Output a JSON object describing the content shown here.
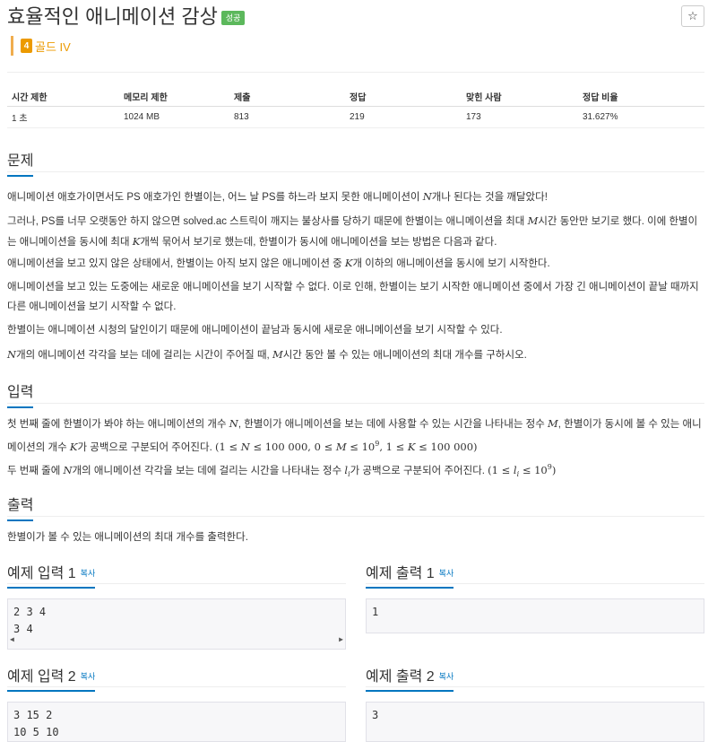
{
  "problem": {
    "title": "효율적인 애니메이션 감상",
    "result_badge": "성공",
    "favorite_icon": "☆",
    "tier_number": "4",
    "tier_label": "골드 IV"
  },
  "stats": {
    "headers": [
      "시간 제한",
      "메모리 제한",
      "제출",
      "정답",
      "맞힌 사람",
      "정답 비율"
    ],
    "values": [
      "1 초",
      "1024 MB",
      "813",
      "219",
      "173",
      "31.627%"
    ]
  },
  "sections": {
    "problem": "문제",
    "input": "입력",
    "output": "출력"
  },
  "statement": {
    "p1a": "애니메이션 애호가이면서도 PS 애호가인 한별이는, 어느 날 PS를 하느라 보지 못한 애니메이션이 ",
    "p1b": "N",
    "p1c": "개나 된다는 것을 깨달았다!",
    "p2a": "그러나, PS를 너무 오랫동안 하지 않으면 solved.ac 스트릭이 깨지는 불상사를 당하기 때문에 한별이는 애니메이션을 최대 ",
    "p2b": "M",
    "p2c": "시간 동안만 보기로 했다. 이에 한별이는 애니메이션을 동시에 최대 ",
    "p2d": "K",
    "p2e": "개씩 묶어서 보기로 했는데, 한별이가 동시에 애니메이션을 보는 방법은 다음과 같다.",
    "p3a": "애니메이션을 보고 있지 않은 상태에서, 한별이는 아직 보지 않은 애니메이션 중 ",
    "p3b": "K",
    "p3c": "개 이하의 애니메이션을 동시에 보기 시작한다.",
    "p4": "애니메이션을 보고 있는 도중에는 새로운 애니메이션을 보기 시작할 수 없다. 이로 인해, 한별이는 보기 시작한 애니메이션 중에서 가장 긴 애니메이션이 끝날 때까지 다른 애니메이션을 보기 시작할 수 없다.",
    "p5": "한별이는 애니메이션 시청의 달인이기 때문에 애니메이션이 끝남과 동시에 새로운 애니메이션을 보기 시작할 수 있다.",
    "p6a": "N",
    "p6b": "개의 애니메이션 각각을 보는 데에 걸리는 시간이 주어질 때, ",
    "p6c": "M",
    "p6d": "시간 동안 볼 수 있는 애니메이션의 최대 개수를 구하시오."
  },
  "input_desc": {
    "l1a": "첫 번째 줄에 한별이가 봐야 하는 애니메이션의 개수 ",
    "l1b": "N",
    "l1c": ", 한별이가 애니메이션을 보는 데에 사용할 수 있는 시간을 나타내는 정수 ",
    "l1d": "M",
    "l1e": ", 한별이가 동시에 볼 수 있는 애니메이션의 개수 ",
    "l1f": "K",
    "l1g": "가 공백으로 구분되어 주어진다. ",
    "l1_constraint_a": "(1 ≤ ",
    "l1_constraint_b": "N",
    "l1_constraint_c": " ≤ 100 000, 0 ≤ ",
    "l1_constraint_d": "M",
    "l1_constraint_e": " ≤ 10",
    "l1_constraint_f": "9",
    "l1_constraint_g": ", 1 ≤ ",
    "l1_constraint_h": "K",
    "l1_constraint_i": " ≤ 100 000)",
    "l2a": "두 번째 줄에 ",
    "l2b": "N",
    "l2c": "개의 애니메이션 각각을 보는 데에 걸리는 시간을 나타내는 정수 ",
    "l2d": "l",
    "l2e": "i",
    "l2f": "가 공백으로 구분되어 주어진다. ",
    "l2_constraint_a": "(1 ≤ ",
    "l2_constraint_b": "l",
    "l2_constraint_c": "i",
    "l2_constraint_d": " ≤ 10",
    "l2_constraint_e": "9",
    "l2_constraint_f": ")"
  },
  "output_desc": "한별이가 볼 수 있는 애니메이션의 최대 개수를 출력한다.",
  "examples": {
    "copy_label": "복사",
    "in1_title": "예제 입력 1",
    "out1_title": "예제 출력 1",
    "in2_title": "예제 입력 2",
    "out2_title": "예제 출력 2",
    "in1": "2 3 4\n3 4",
    "out1": "1",
    "in2": "3 15 2\n10 5 10",
    "out2": "3"
  }
}
